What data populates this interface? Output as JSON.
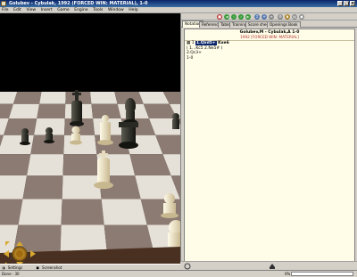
{
  "window": {
    "title": "Golubev - Cybulak, 1992 (FORCED WIN: MATERIAL), 1-0",
    "controls": [
      "_",
      "□",
      "×"
    ]
  },
  "menu": [
    "File",
    "Edit",
    "View",
    "Insert",
    "Game",
    "Engine",
    "Tools",
    "Window",
    "Help"
  ],
  "tabs": [
    "Notation",
    "Reference",
    "Table",
    "Training",
    "Score sheet",
    "Openings Book"
  ],
  "active_tab": "Notation",
  "game": {
    "header": "Golubev,M - Cybulak,A  1-0",
    "subheader": "1992 [FORCED WIN: MATERIAL]",
    "move_number": "1",
    "move_highlight": "1.Qxd5+",
    "move_rest": "Kxe6",
    "variation": "( 1...Kc5  2.Ne5# )",
    "line3": "2.Qc3+",
    "result": "1-0"
  },
  "board_pane": {
    "settings_label": "Settings",
    "screenshot_label": "Screenshot"
  },
  "statusbar": {
    "text": "Done - 30",
    "percent": "0%",
    "progress": 0
  },
  "colors": {
    "title_bar": "#0a246a",
    "notation_bg": "#fffde8",
    "highlight": "#0a246a",
    "light_square": "#e6e1d8",
    "dark_square": "#8c7b72"
  }
}
